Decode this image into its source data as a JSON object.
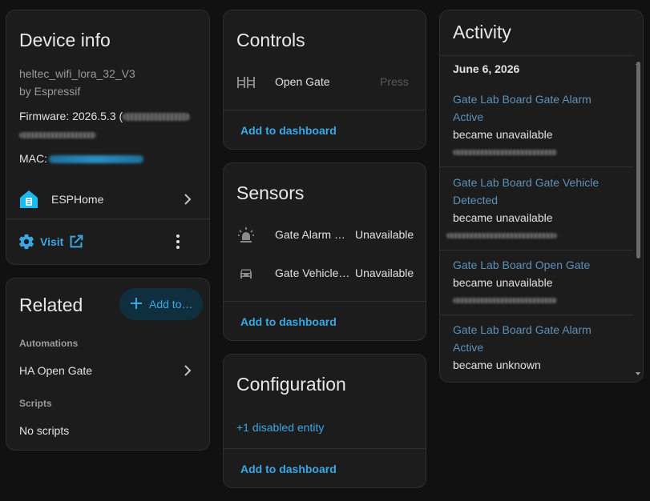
{
  "device_info": {
    "title": "Device info",
    "model": "heltec_wifi_lora_32_V3",
    "manufacturer": "by Espressif",
    "firmware_label": "Firmware: 2026.5.3 (",
    "mac_label": "MAC:",
    "integration": "ESPHome",
    "visit_label": "Visit"
  },
  "related": {
    "title": "Related",
    "add_button": "Add to…",
    "automations_label": "Automations",
    "automation_item": "HA Open Gate",
    "scripts_label": "Scripts",
    "scripts_value": "No scripts"
  },
  "controls": {
    "title": "Controls",
    "items": [
      {
        "name": "Open Gate",
        "action": "Press"
      }
    ],
    "add_to_dashboard": "Add to dashboard"
  },
  "sensors": {
    "title": "Sensors",
    "items": [
      {
        "name": "Gate Alarm …",
        "state": "Unavailable"
      },
      {
        "name": "Gate Vehicle…",
        "state": "Unavailable"
      }
    ],
    "add_to_dashboard": "Add to dashboard"
  },
  "configuration": {
    "title": "Configuration",
    "disabled_entities": "+1 disabled entity",
    "add_to_dashboard": "Add to dashboard"
  },
  "activity": {
    "title": "Activity",
    "date": "June 6, 2026",
    "entries": [
      {
        "title_line1": "Gate Lab Board Gate Alarm",
        "title_line2": "Active",
        "status": "became unavailable"
      },
      {
        "title_line1": "Gate Lab Board Gate Vehicle",
        "title_line2": "Detected",
        "status": "became unavailable"
      },
      {
        "title_line1": "Gate Lab Board Open Gate",
        "title_line2": "",
        "status": "became unavailable"
      },
      {
        "title_line1": "Gate Lab Board Gate Alarm",
        "title_line2": "Active",
        "status": "became unknown"
      }
    ]
  },
  "colors": {
    "accent": "#3ba8e6",
    "activity_link": "#5e91b8",
    "card_bg": "#1c1c1c",
    "page_bg": "#111111"
  }
}
